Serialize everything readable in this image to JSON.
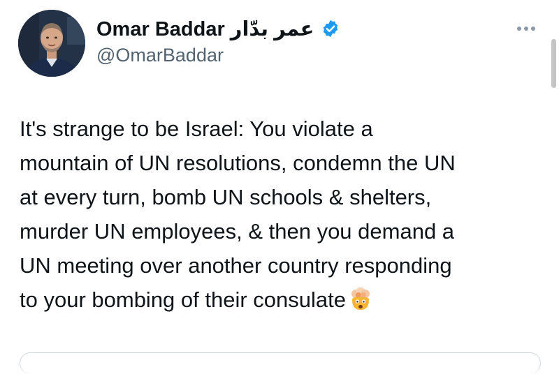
{
  "tweet": {
    "author": {
      "display_name": "Omar Baddar عمر بدّار",
      "handle": "@OmarBaddar",
      "verified": true
    },
    "text_lines": [
      "It's strange to be Israel: You violate a",
      "mountain of UN resolutions, condemn the UN",
      "at every turn, bomb UN schools & shelters,",
      "murder UN employees, & then you demand a",
      "UN meeting over another country responding",
      "to your bombing of their consulate"
    ],
    "emoji": "exploding-head"
  },
  "icons": {
    "verified": "verified-badge-icon",
    "more": "more-options-icon"
  },
  "colors": {
    "verified": "#1d9bf0",
    "text": "#0f1419",
    "secondary": "#536471",
    "border": "#cfd9de"
  }
}
